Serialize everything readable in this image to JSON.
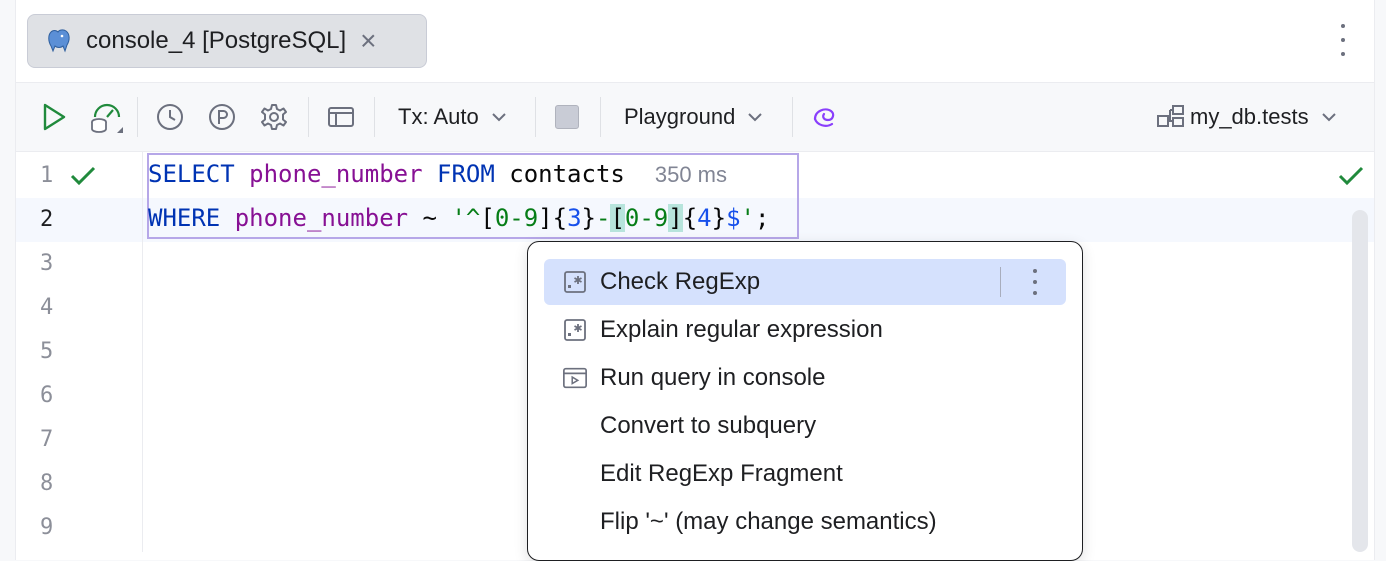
{
  "tab": {
    "label": "console_4 [PostgreSQL]",
    "close_glyph": "×",
    "icon": "postgresql-elephant-icon"
  },
  "toolbar": {
    "tx_label": "Tx: Auto",
    "playground_label": "Playground",
    "datasource_label": "my_db.tests"
  },
  "editor": {
    "line_numbers": [
      "1",
      "2",
      "3",
      "4",
      "5",
      "6",
      "7",
      "8",
      "9"
    ],
    "line1": {
      "kw1": "SELECT",
      "col": "phone_number",
      "kw2": "FROM",
      "table": "contacts",
      "timing": "350 ms"
    },
    "line2": {
      "kw": "WHERE",
      "col": "phone_number",
      "op": " ~ ",
      "q1": "'^",
      "b1": "[",
      "r1": "0-9",
      "b2": "]",
      "c1": "{",
      "n1": "3",
      "c2": "}",
      "dash": "-",
      "b3": "[",
      "r2": "0-9",
      "b4": "]",
      "c3": "{",
      "n2": "4",
      "c4": "}",
      "dollar": "$",
      "q2": "'",
      "semi": ";"
    }
  },
  "popup": {
    "items": [
      {
        "label": "Check RegExp",
        "icon": "regexp-icon"
      },
      {
        "label": "Explain regular expression",
        "icon": "regexp-icon"
      },
      {
        "label": "Run query in console",
        "icon": "console-run-icon"
      },
      {
        "label": "Convert to subquery",
        "icon": ""
      },
      {
        "label": "Edit RegExp Fragment",
        "icon": ""
      },
      {
        "label": "Flip '~' (may change semantics)",
        "icon": ""
      }
    ]
  },
  "colors": {
    "keyword": "#0033b3",
    "identifier": "#871094",
    "string": "#067d17",
    "number": "#1750eb",
    "selection": "#d5e1fd",
    "success": "#208a3c"
  }
}
